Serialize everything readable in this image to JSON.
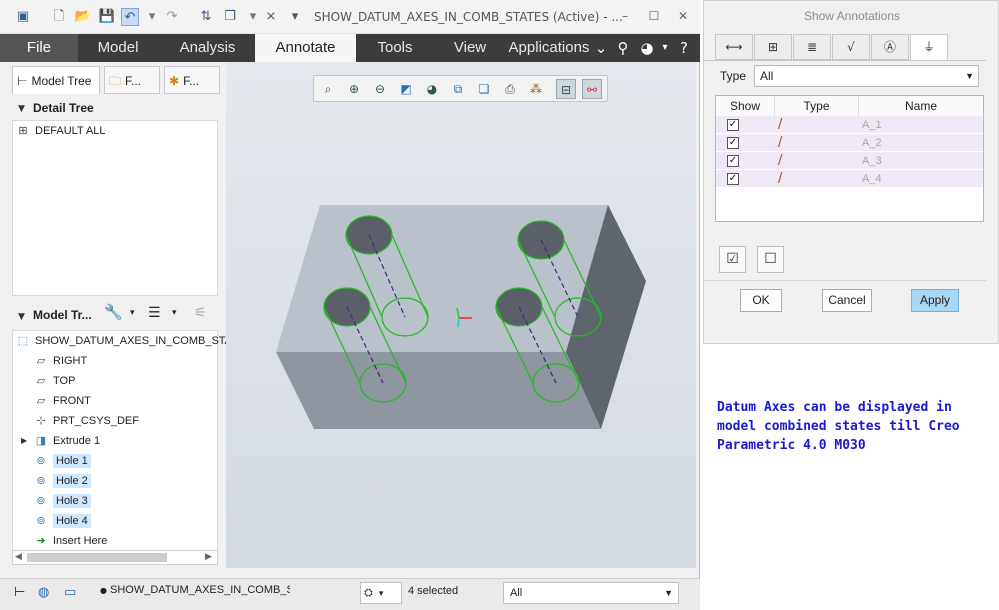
{
  "window": {
    "title": "SHOW_DATUM_AXES_IN_COMB_STATES (Active) - ...",
    "controls": [
      "–",
      "☐",
      "✕"
    ]
  },
  "ribbon": {
    "tabs": [
      "File",
      "Model",
      "Analysis",
      "Annotate",
      "Tools",
      "View",
      "Applications"
    ],
    "active_tab": "Annotate",
    "right_icons": [
      "chevron-down-icon",
      "search-icon",
      "community-icon",
      "help-icon"
    ]
  },
  "left_panel": {
    "tabs": [
      "Model Tree",
      "F...",
      "F..."
    ],
    "detail_tree": {
      "header": "Detail Tree",
      "items": [
        "DEFAULT ALL"
      ]
    },
    "model_tree": {
      "header": "Model Tr...",
      "items": [
        {
          "label": "SHOW_DATUM_AXES_IN_COMB_STATES",
          "icon": "part-icon",
          "selected": false,
          "expand": false
        },
        {
          "label": "RIGHT",
          "icon": "datum-plane-icon",
          "selected": false,
          "expand": false
        },
        {
          "label": "TOP",
          "icon": "datum-plane-icon",
          "selected": false,
          "expand": false
        },
        {
          "label": "FRONT",
          "icon": "datum-plane-icon",
          "selected": false,
          "expand": false
        },
        {
          "label": "PRT_CSYS_DEF",
          "icon": "csys-icon",
          "selected": false,
          "expand": false
        },
        {
          "label": "Extrude 1",
          "icon": "extrude-icon",
          "selected": false,
          "expand": true
        },
        {
          "label": "Hole 1",
          "icon": "hole-icon",
          "selected": true,
          "expand": false
        },
        {
          "label": "Hole 2",
          "icon": "hole-icon",
          "selected": true,
          "expand": false
        },
        {
          "label": "Hole 3",
          "icon": "hole-icon",
          "selected": true,
          "expand": false
        },
        {
          "label": "Hole 4",
          "icon": "hole-icon",
          "selected": true,
          "expand": false
        },
        {
          "label": "Insert Here",
          "icon": "arrow-right-icon",
          "selected": false,
          "expand": false
        }
      ]
    }
  },
  "graphics_toolbar": {
    "icons": [
      "refit-icon",
      "zoom-in-icon",
      "zoom-out-icon",
      "repaint-icon",
      "display-style-icon",
      "saved-orientations-icon",
      "view-manager-icon",
      "perspective-icon",
      "datum-display-icon",
      "spin-center-icon",
      "annotation-display-icon"
    ]
  },
  "status_bar": {
    "model_label": "SHOW_DATUM_AXES_IN_COMB_STA",
    "selected_text": "4 selected",
    "filter_value": "All"
  },
  "dialog": {
    "title": "Show Annotations",
    "tabs": [
      "dimension-icon",
      "geometric-tolerance-icon",
      "note-icon",
      "surface-finish-icon",
      "symbol-icon",
      "datum-icon"
    ],
    "active_tab_index": 5,
    "type_label": "Type",
    "type_value": "All",
    "columns": [
      "Show",
      "Type",
      "Name"
    ],
    "rows": [
      {
        "checked": true,
        "name": "A_1"
      },
      {
        "checked": true,
        "name": "A_2"
      },
      {
        "checked": true,
        "name": "A_3"
      },
      {
        "checked": true,
        "name": "A_4"
      }
    ],
    "buttons": {
      "ok": "OK",
      "cancel": "Cancel",
      "apply": "Apply"
    }
  },
  "note": {
    "text": "Datum Axes can be displayed in model combined states till Creo Parametric 4.0 M030",
    "color": "#1a1ad0"
  },
  "colors": {
    "ribbon_bg": "#3c3c3c",
    "part_top": "#b9c1cb",
    "part_front": "#8e96a0",
    "part_side": "#5f656d",
    "hole_outline": "#22bb22",
    "axis_line": "#3b2a7a",
    "selection": "#cde8ff"
  }
}
